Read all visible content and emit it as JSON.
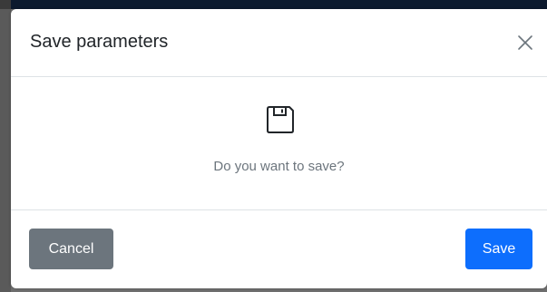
{
  "modal": {
    "title": "Save parameters",
    "close_icon": "close-icon",
    "body_icon": "floppy-disk-icon",
    "body_text": "Do you want to save?",
    "cancel_label": "Cancel",
    "save_label": "Save"
  },
  "colors": {
    "primary": "#0d6efd",
    "secondary": "#6c757d",
    "title_text": "#212529",
    "muted_text": "#6c757d",
    "divider": "#dee2e6"
  }
}
